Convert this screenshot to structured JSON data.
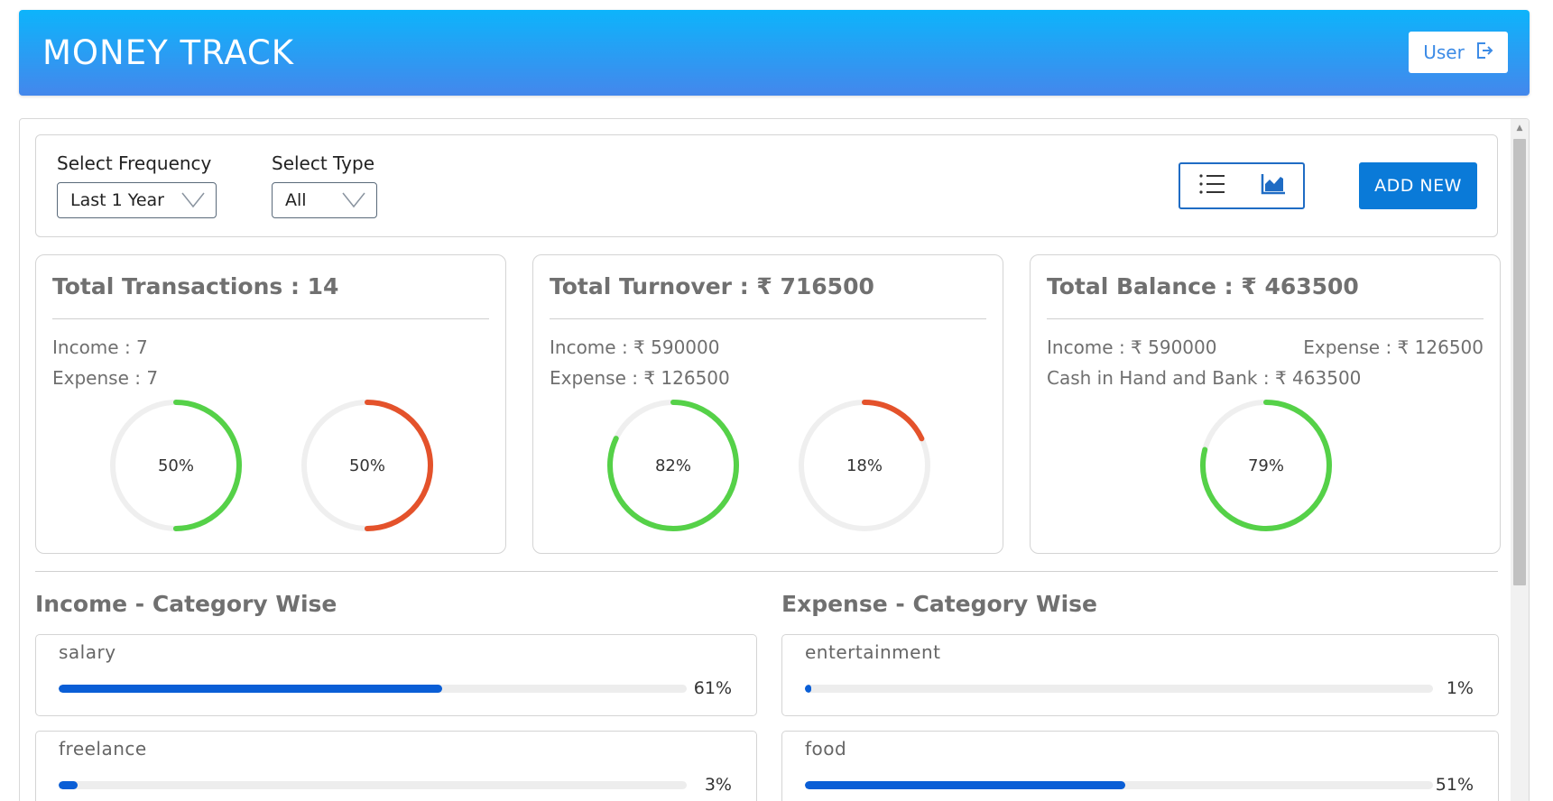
{
  "header": {
    "title": "MONEY TRACK",
    "user_label": "User"
  },
  "filters": {
    "frequency": {
      "label": "Select Frequency",
      "value": "Last 1 Year"
    },
    "type": {
      "label": "Select Type",
      "value": "All"
    }
  },
  "toolbar": {
    "add_label": "ADD NEW",
    "views": [
      "list-icon",
      "chart-icon"
    ]
  },
  "colors": {
    "income": "#55d148",
    "expense": "#e4522b",
    "track": "#efefef",
    "bar": "#0a5ed6",
    "accent": "#1f6cc4"
  },
  "stats": {
    "transactions": {
      "title": "Total Transactions : 14",
      "income": "Income : 7",
      "expense": "Expense : 7",
      "income_pct": 50,
      "income_pct_label": "50%",
      "expense_pct": 50,
      "expense_pct_label": "50%"
    },
    "turnover": {
      "title": "Total Turnover : ₹ 716500",
      "income": "Income : ₹ 590000",
      "expense": "Expense : ₹ 126500",
      "income_pct": 82,
      "income_pct_label": "82%",
      "expense_pct": 18,
      "expense_pct_label": "18%"
    },
    "balance": {
      "title": "Total Balance : ₹ 463500",
      "income": "Income : ₹ 590000",
      "expense": "Expense : ₹ 126500",
      "cash": "Cash in Hand and Bank : ₹ 463500",
      "pct": 79,
      "pct_label": "79%"
    }
  },
  "income_categories": {
    "title": "Income - Category Wise",
    "items": [
      {
        "name": "salary",
        "pct": 61,
        "pct_label": "61%"
      },
      {
        "name": "freelance",
        "pct": 3,
        "pct_label": "3%"
      }
    ]
  },
  "expense_categories": {
    "title": "Expense - Category Wise",
    "items": [
      {
        "name": "entertainment",
        "pct": 1,
        "pct_label": "1%"
      },
      {
        "name": "food",
        "pct": 51,
        "pct_label": "51%"
      }
    ]
  }
}
